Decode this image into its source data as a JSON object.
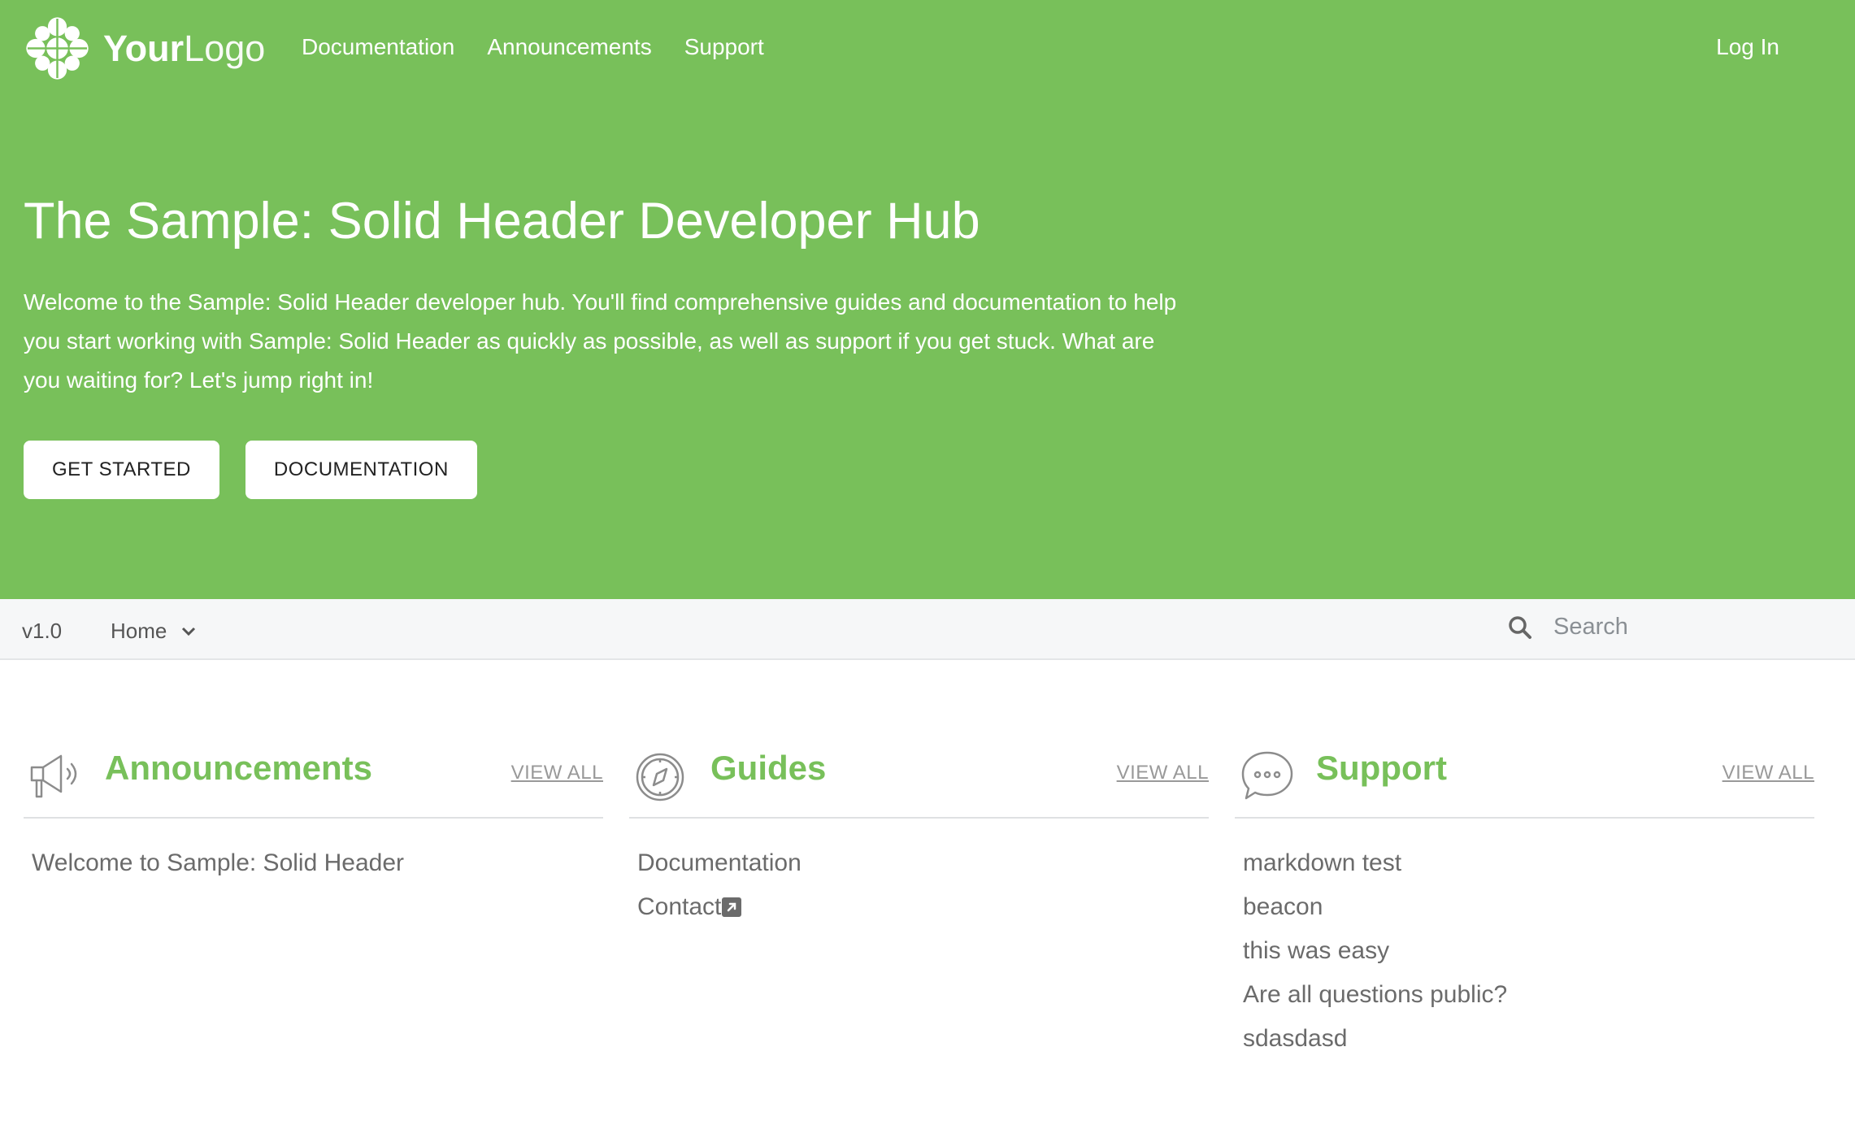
{
  "header": {
    "logo_bold": "Your",
    "logo_light": "Logo",
    "nav": [
      {
        "label": "Documentation"
      },
      {
        "label": "Announcements"
      },
      {
        "label": "Support"
      }
    ],
    "login": "Log In"
  },
  "hero": {
    "title": "The Sample: Solid Header Developer Hub",
    "description": "Welcome to the Sample: Solid Header developer hub. You'll find comprehensive guides and documentation to help you start working with Sample: Solid Header as quickly as possible, as well as support if you get stuck. What are you waiting for? Let's jump right in!",
    "buttons": [
      {
        "label": "GET STARTED"
      },
      {
        "label": "DOCUMENTATION"
      }
    ]
  },
  "subbar": {
    "version": "v1.0",
    "home": "Home",
    "search_placeholder": "Search"
  },
  "sections": [
    {
      "title": "Announcements",
      "view_all": "VIEW ALL",
      "icon": "megaphone-icon",
      "items": [
        "Welcome to Sample: Solid Header"
      ]
    },
    {
      "title": "Guides",
      "view_all": "VIEW ALL",
      "icon": "compass-icon",
      "items": [
        "Documentation",
        "Contact"
      ]
    },
    {
      "title": "Support",
      "view_all": "VIEW ALL",
      "icon": "chat-bubble-icon",
      "items": [
        "markdown test",
        "beacon",
        "this was easy",
        "Are all questions public?",
        "sdasdasd"
      ]
    }
  ],
  "colors": {
    "brand": "#78c05a",
    "subbar": "#f6f7f8",
    "muted": "#999999"
  }
}
